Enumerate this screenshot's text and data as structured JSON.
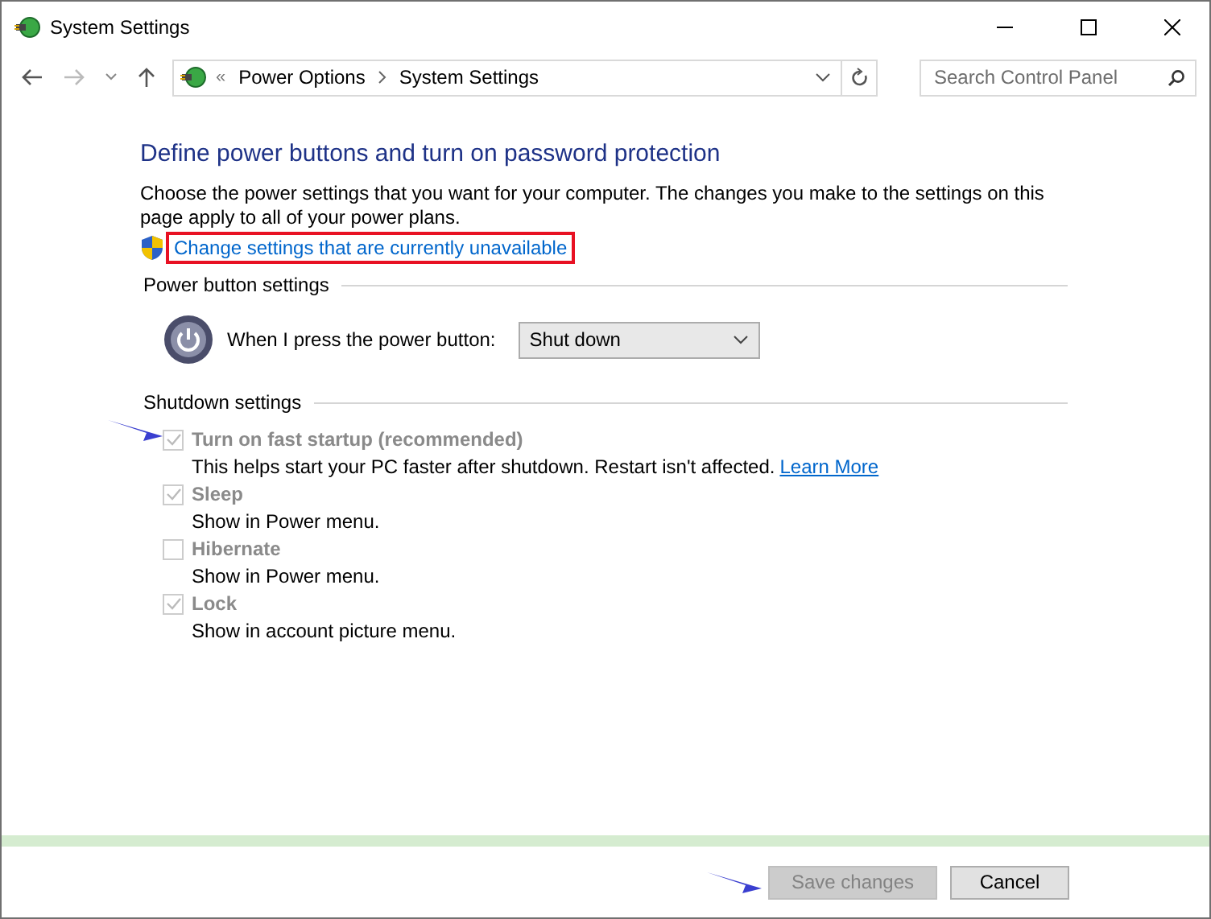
{
  "window": {
    "title": "System Settings"
  },
  "nav": {
    "breadcrumb_prefix": "«",
    "breadcrumb": [
      "Power Options",
      "System Settings"
    ],
    "search": {
      "placeholder": "Search Control Panel"
    }
  },
  "heading": "Define power buttons and turn on password protection",
  "intro": "Choose the power settings that you want for your computer. The changes you make to the settings on this page apply to all of your power plans.",
  "admin_link": {
    "label": "Change settings that are currently unavailable",
    "highlighted": true
  },
  "power_button_section": {
    "title": "Power button settings",
    "label": "When I press the power button:",
    "value": "Shut down"
  },
  "shutdown_section": {
    "title": "Shutdown settings",
    "options": [
      {
        "label": "Turn on fast startup (recommended)",
        "description": "This helps start your PC faster after shutdown. Restart isn't affected.",
        "link": "Learn More",
        "checked": true,
        "disabled": true,
        "pointed": true
      },
      {
        "label": "Sleep",
        "description": "Show in Power menu.",
        "checked": true,
        "disabled": true,
        "pointed": false
      },
      {
        "label": "Hibernate",
        "description": "Show in Power menu.",
        "checked": false,
        "disabled": true,
        "pointed": false
      },
      {
        "label": "Lock",
        "description": "Show in account picture menu.",
        "checked": true,
        "disabled": true,
        "pointed": false
      }
    ]
  },
  "buttons": [
    {
      "label": "Save changes",
      "disabled": true,
      "pointed": true
    },
    {
      "label": "Cancel",
      "disabled": false,
      "pointed": false
    }
  ]
}
